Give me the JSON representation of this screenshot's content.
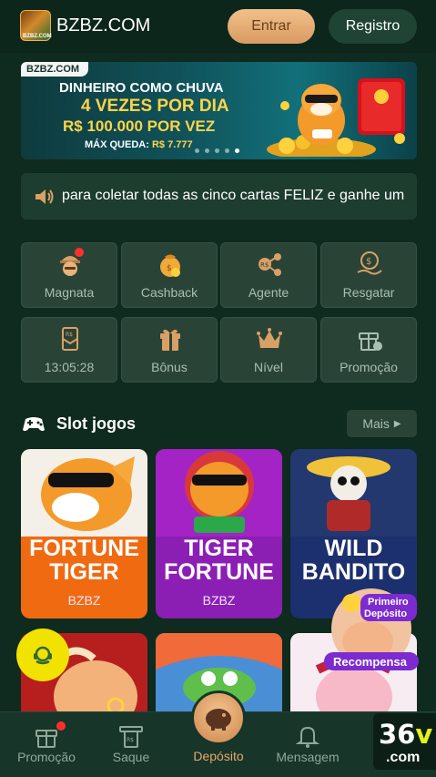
{
  "header": {
    "site_name": "BZBZ.COM",
    "logo_text": "BZBZ.COM",
    "login_label": "Entrar",
    "register_label": "Registro"
  },
  "banner": {
    "tag": "BZBZ.COM",
    "line1": "DINHEIRO COMO CHUVA",
    "line2": "4 VEZES POR DIA",
    "line3": "R$ 100.000 POR VEZ",
    "line4_label": "MÁX QUEDA:",
    "line4_value": "R$ 7.777",
    "slide_count": 5,
    "active_slide": 5
  },
  "marquee": {
    "text": "para coletar todas as cinco cartas FELIZ e ganhe um"
  },
  "menu": [
    {
      "label": "Magnata",
      "icon": "tycoon-icon",
      "badge": true
    },
    {
      "label": "Cashback",
      "icon": "cashback-bag-icon",
      "badge": false
    },
    {
      "label": "Agente",
      "icon": "agent-share-icon",
      "badge": false
    },
    {
      "label": "Resgatar",
      "icon": "redeem-coin-hand-icon",
      "badge": false
    },
    {
      "label": "13:05:28",
      "icon": "envelope-icon",
      "badge": false
    },
    {
      "label": "Bônus",
      "icon": "bonus-gift-icon",
      "badge": false
    },
    {
      "label": "Nível",
      "icon": "crown-icon",
      "badge": false
    },
    {
      "label": "Promoção",
      "icon": "promo-gift-icon",
      "badge": false
    }
  ],
  "slots": {
    "title": "Slot jogos",
    "more_label": "Mais",
    "games": [
      {
        "line1": "FORTUNE",
        "line2": "TIGER",
        "provider": "BZBZ",
        "bg": "#f06a12"
      },
      {
        "line1": "TIGER",
        "line2": "FORTUNE",
        "provider": "BZBZ",
        "bg": "#8b1fb4"
      },
      {
        "line1": "WILD",
        "line2": "BANDITO",
        "provider": "",
        "bg": "#1c2f6e"
      }
    ]
  },
  "promo_badge": {
    "line1": "Primeiro",
    "line2": "Depósito",
    "line3": "Recompensa"
  },
  "bottom_nav": {
    "items": [
      {
        "label": "Promoção",
        "icon": "gift-icon"
      },
      {
        "label": "Saque",
        "icon": "withdraw-icon"
      },
      {
        "label": "Depósito",
        "icon": "piggy-bank-icon"
      },
      {
        "label": "Mensagem",
        "icon": "bell-icon"
      }
    ]
  },
  "watermark": {
    "big": "36",
    "v": "v",
    "domain": ".com"
  },
  "colors": {
    "background": "#0f2a1e",
    "accent": "#e8a86b",
    "tile": "#2a4337"
  }
}
